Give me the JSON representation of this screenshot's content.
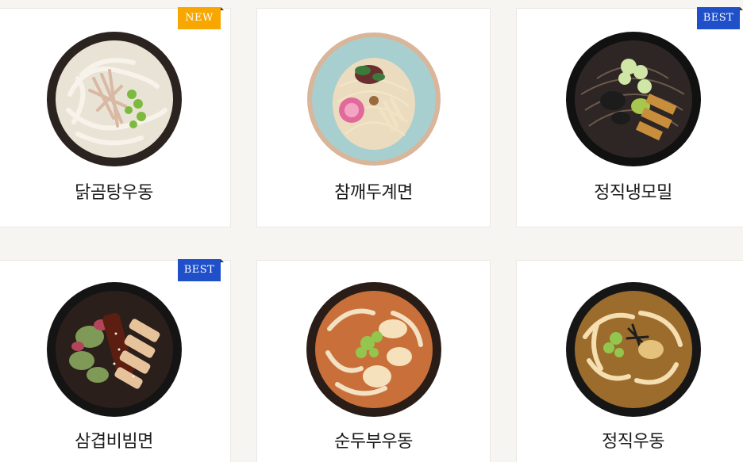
{
  "menu": {
    "items": [
      {
        "name": "닭곰탕우동",
        "badge": "NEW",
        "badge_color": "#f7a700",
        "icon": "chicken-udon-bowl-icon"
      },
      {
        "name": "참깨두계면",
        "badge": "",
        "icon": "sesame-noodle-bowl-icon"
      },
      {
        "name": "정직냉모밀",
        "badge": "BEST",
        "badge_color": "#1f4fc9",
        "icon": "cold-soba-bowl-icon"
      },
      {
        "name": "삼겹비빔면",
        "badge": "BEST",
        "badge_color": "#1f4fc9",
        "icon": "pork-belly-bibim-bowl-icon"
      },
      {
        "name": "순두부우동",
        "badge": "",
        "icon": "soft-tofu-udon-bowl-icon"
      },
      {
        "name": "정직우동",
        "badge": "",
        "icon": "classic-udon-bowl-icon"
      }
    ]
  },
  "colors": {
    "background": "#f6f5f2",
    "card": "#ffffff",
    "new_badge": "#f7a700",
    "best_badge": "#1f4fc9",
    "text": "#1b1b1b"
  }
}
